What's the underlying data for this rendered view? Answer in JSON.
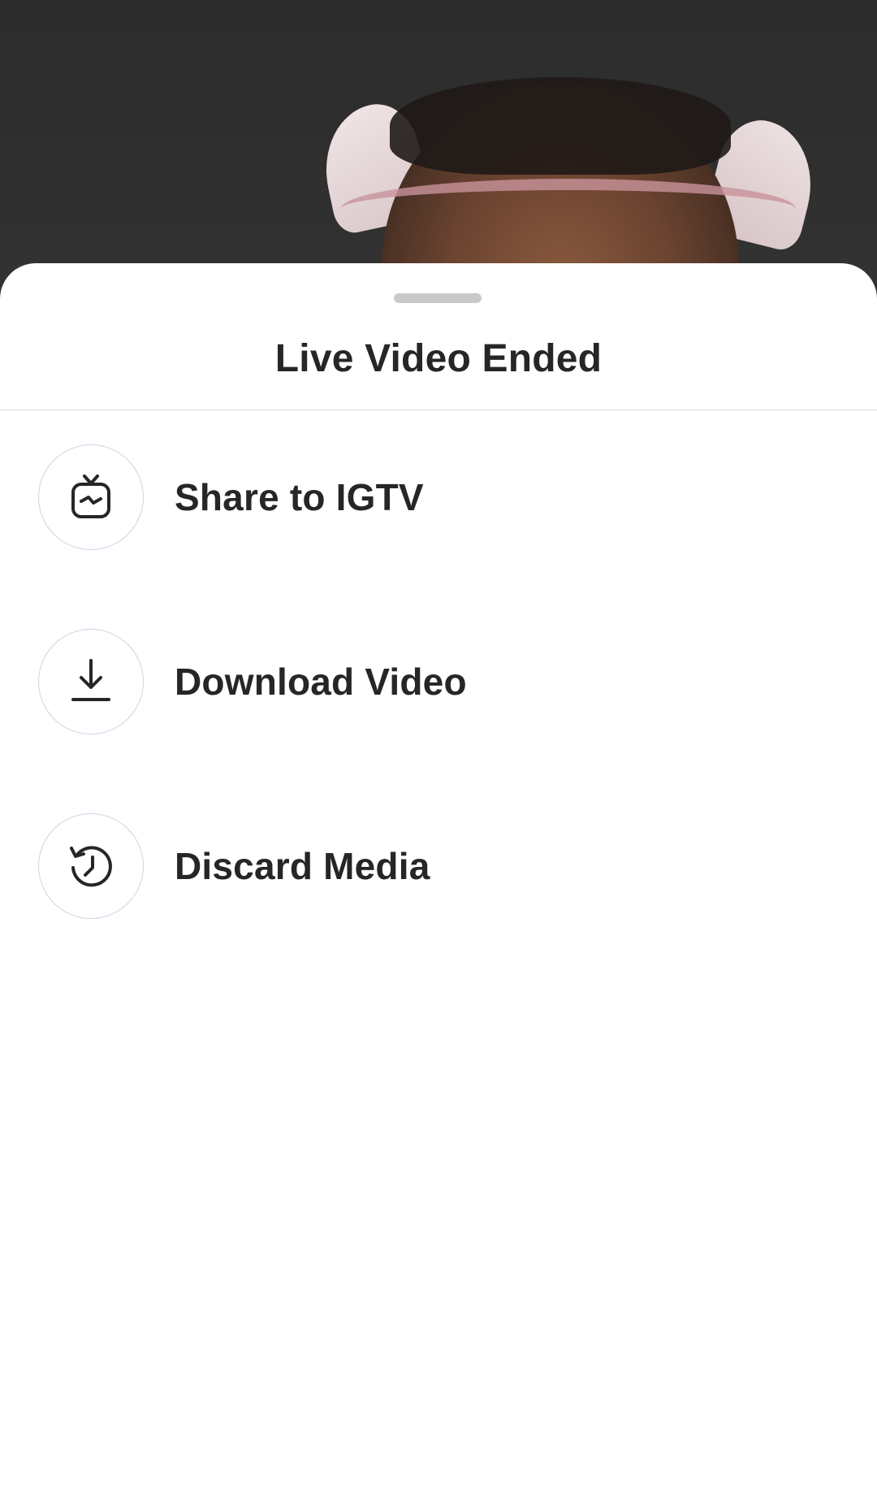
{
  "sheet": {
    "title": "Live Video Ended"
  },
  "menu": {
    "items": [
      {
        "label": "Share to IGTV",
        "icon": "igtv-icon"
      },
      {
        "label": "Download Video",
        "icon": "download-icon"
      },
      {
        "label": "Discard Media",
        "icon": "discard-history-icon"
      }
    ]
  },
  "colors": {
    "sheet_background": "#ffffff",
    "text": "#262626",
    "handle": "#c9c9c9",
    "divider": "#dbdbdb",
    "icon_ring": "#d4d0e6",
    "backdrop": "#2c2c2c"
  }
}
